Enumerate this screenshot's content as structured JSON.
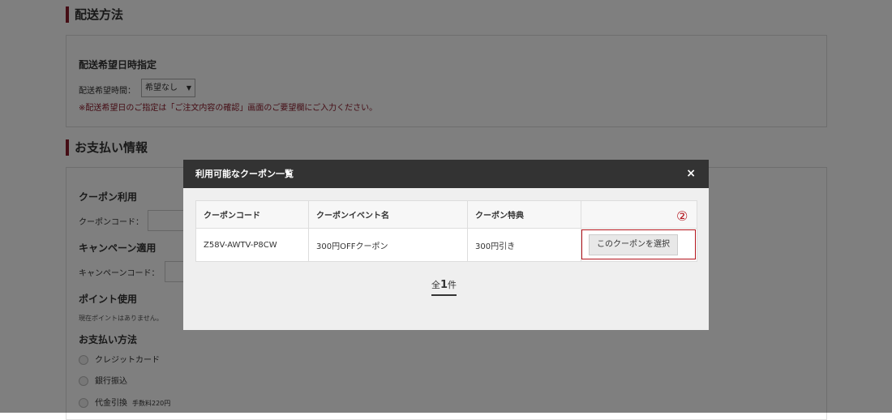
{
  "delivery": {
    "title": "配送方法",
    "subtitle": "配送希望日時指定",
    "time_label": "配送希望時間：",
    "time_value": "希望なし",
    "note": "※配送希望日のご指定は「ご注文内容の確認」画面のご要望欄にご入力ください。"
  },
  "payment": {
    "title": "お支払い情報",
    "coupon_heading": "クーポン利用",
    "coupon_code_label": "クーポンコード：",
    "campaign_heading": "キャンペーン適用",
    "campaign_code_label": "キャンペーンコード：",
    "points_heading": "ポイント使用",
    "points_note": "現在ポイントはありません。",
    "method_heading": "お支払い方法",
    "methods": [
      {
        "label": "クレジットカード",
        "fee": ""
      },
      {
        "label": "銀行振込",
        "fee": ""
      },
      {
        "label": "代金引換",
        "fee": "手数料220円"
      }
    ]
  },
  "modal": {
    "title": "利用可能なクーポン一覧",
    "close_icon": "close-icon",
    "close_glyph": "×",
    "columns": [
      "クーポンコード",
      "クーポンイベント名",
      "クーポン特典",
      ""
    ],
    "rows": [
      {
        "code": "Z58V-AWTV-P8CW",
        "event": "300円OFFクーポン",
        "benefit": "300円引き",
        "button": "このクーポンを選択"
      }
    ],
    "marker": "②",
    "count_prefix": "全",
    "count_value": "1",
    "count_suffix": "件"
  },
  "colors": {
    "accent": "#8b1a2b",
    "annotation": "#b3131b",
    "modal_header": "#333333",
    "overlay": "rgba(0,0,0,0.5)"
  }
}
